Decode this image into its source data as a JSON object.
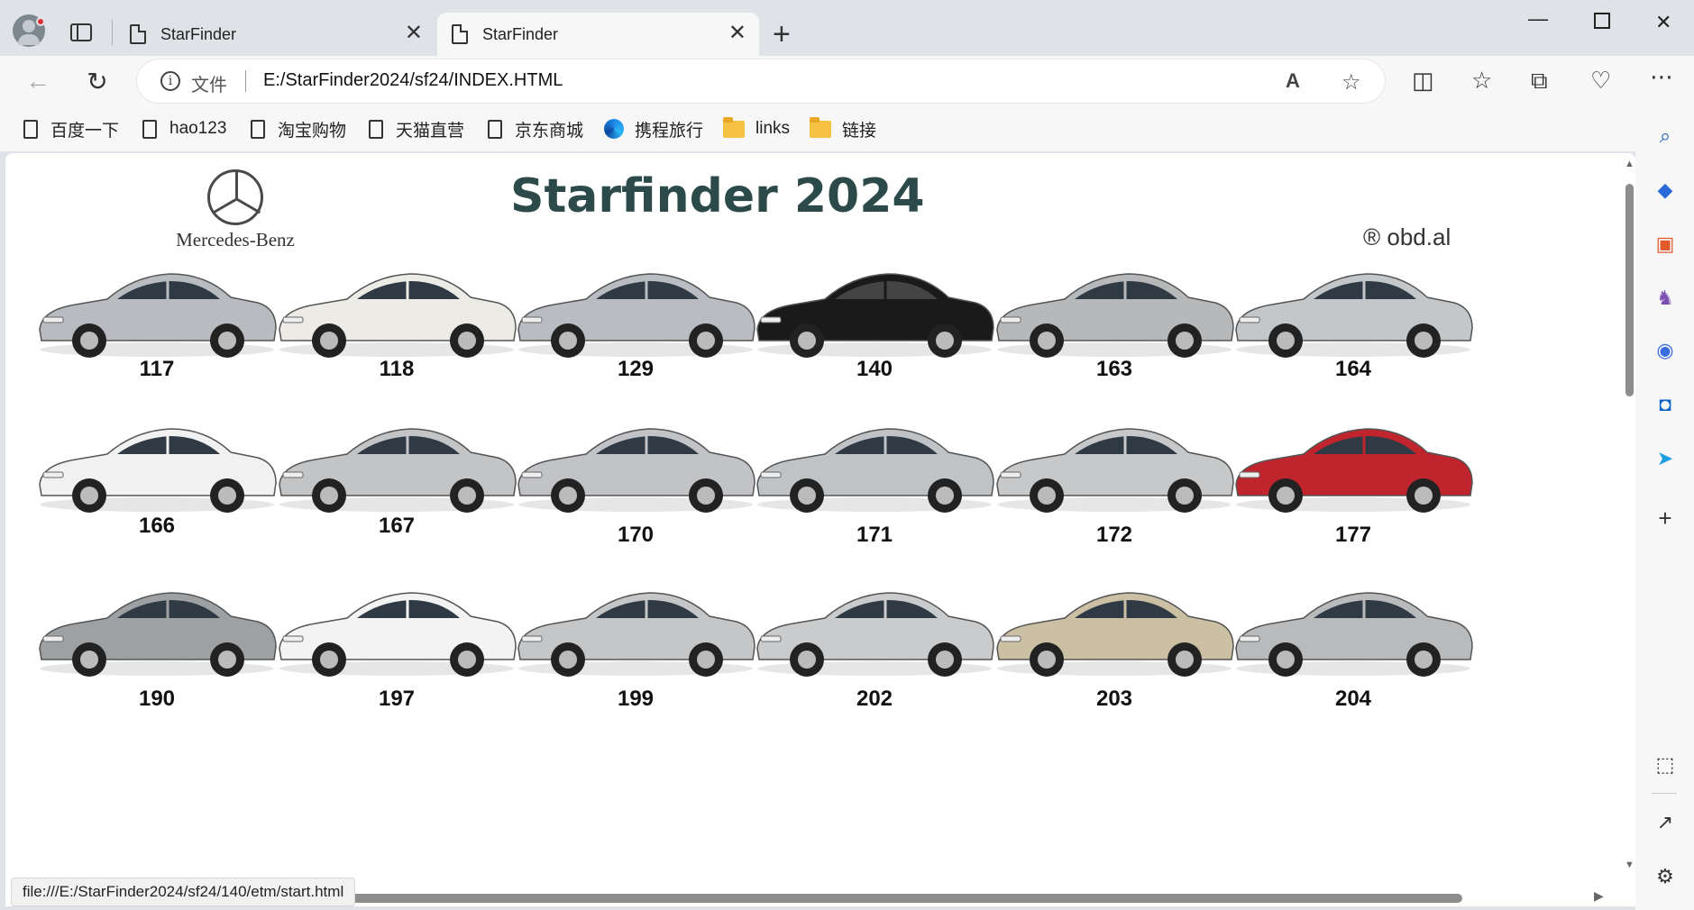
{
  "browser": {
    "tabs": [
      {
        "title": "StarFinder",
        "active": false
      },
      {
        "title": "StarFinder",
        "active": true
      }
    ],
    "address": {
      "scheme_label": "文件",
      "url": "E:/StarFinder2024/sf24/INDEX.HTML"
    },
    "bookmarks": [
      {
        "label": "百度一下",
        "type": "page"
      },
      {
        "label": "hao123",
        "type": "page"
      },
      {
        "label": "淘宝购物",
        "type": "page"
      },
      {
        "label": "天猫直营",
        "type": "page"
      },
      {
        "label": "京东商城",
        "type": "page"
      },
      {
        "label": "携程旅行",
        "type": "ctrip"
      },
      {
        "label": "links",
        "type": "folder"
      },
      {
        "label": "链接",
        "type": "folder"
      }
    ],
    "status_url": "file:///E:/StarFinder2024/sf24/140/etm/start.html"
  },
  "page": {
    "brand": "Mercedes-Benz",
    "title": "Starfinder 2024",
    "copyright": "® obd.al",
    "models": [
      {
        "code": "117",
        "color": "#b8bcc0"
      },
      {
        "code": "118",
        "color": "#ecebe6"
      },
      {
        "code": "129",
        "color": "#b9bdc2"
      },
      {
        "code": "140",
        "color": "#1a1a1a"
      },
      {
        "code": "163",
        "color": "#b6b8ba"
      },
      {
        "code": "164",
        "color": "#c4c7ca"
      },
      {
        "code": "166",
        "color": "#f1f1f1"
      },
      {
        "code": "167",
        "color": "#c2c4c6"
      },
      {
        "code": "170",
        "color": "#c1c3c6"
      },
      {
        "code": "171",
        "color": "#bfc3c6"
      },
      {
        "code": "172",
        "color": "#c6c8ca"
      },
      {
        "code": "177",
        "color": "#c0242c"
      },
      {
        "code": "190",
        "color": "#9ea1a4"
      },
      {
        "code": "197",
        "color": "#f3f3f3"
      },
      {
        "code": "199",
        "color": "#c4c6c8"
      },
      {
        "code": "202",
        "color": "#c9cbcd"
      },
      {
        "code": "203",
        "color": "#cbbfa4"
      },
      {
        "code": "204",
        "color": "#b8babc"
      }
    ]
  }
}
